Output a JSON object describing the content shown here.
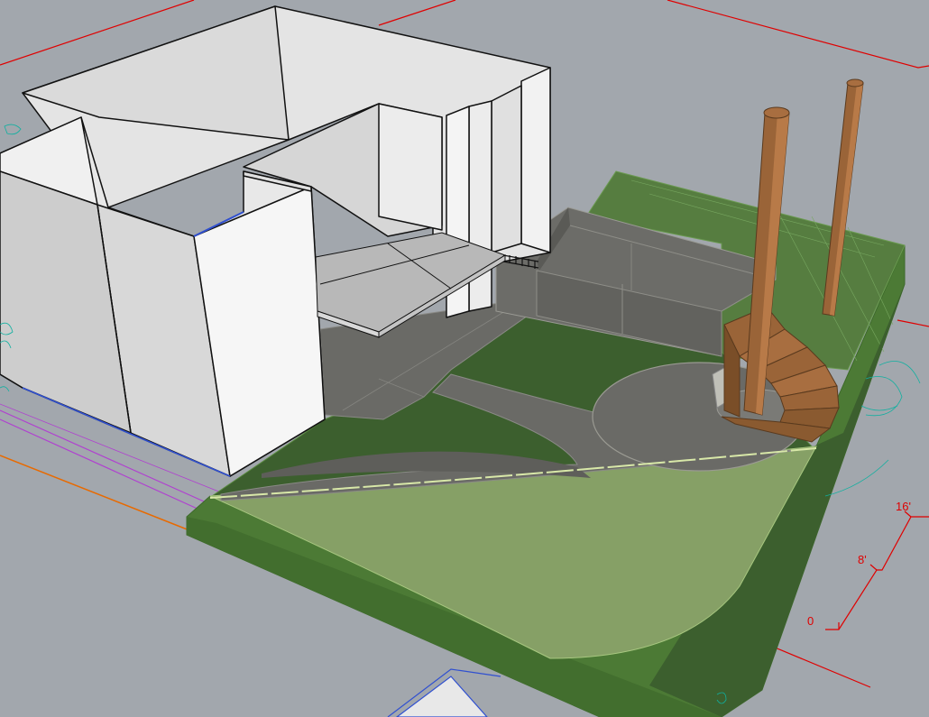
{
  "viewport": {
    "background": "#a2a7ad",
    "view": "perspective"
  },
  "scale_bar": {
    "labels": [
      "16'",
      "8'",
      "0"
    ],
    "color": "#e00000"
  },
  "colors": {
    "wall": "#e6e6e6",
    "wall_shade": "#cfcfcf",
    "paving": "#6a6a66",
    "lawn_dark": "#3c5f2e",
    "lawn_light": "#86a066",
    "turf_side": "#4c7a35",
    "timber": "#9a6438",
    "site_outline": "#e00000"
  },
  "model_objects": [
    "house-walls",
    "deck-slab",
    "paving-terrace",
    "retaining-wall",
    "lawn-upper",
    "lawn-lower",
    "spiral-stair",
    "timber-post-left",
    "timber-post-right"
  ]
}
